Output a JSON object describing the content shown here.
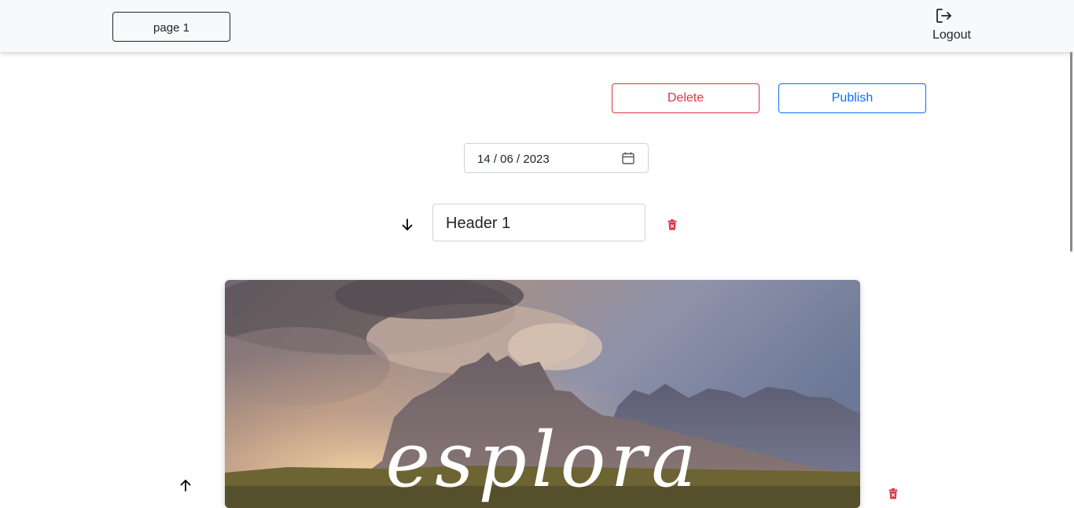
{
  "navbar": {
    "page_button": "page 1",
    "logout_label": "Logout"
  },
  "actions": {
    "delete_label": "Delete",
    "publish_label": "Publish"
  },
  "date_field": {
    "value": "14 / 06 / 2023"
  },
  "header_block": {
    "value": "Header 1"
  },
  "image_block": {
    "overlay_text": "esplora"
  },
  "icons": {
    "logout": "logout-icon",
    "calendar": "calendar-icon",
    "move_down": "arrow-down-icon",
    "move_up": "arrow-up-icon",
    "delete_block": "trash-icon"
  },
  "colors": {
    "danger": "#dc3545",
    "primary": "#0d6efd",
    "navbar_bg": "#f8f9fa",
    "text": "#212529"
  }
}
